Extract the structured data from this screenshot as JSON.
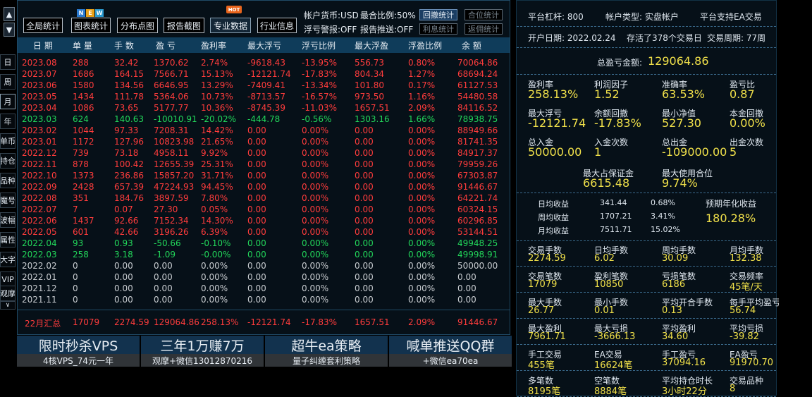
{
  "sidebar": {
    "up_arrow": "▲",
    "down_arrow": "▼",
    "items": [
      "日",
      "周",
      "月",
      "年",
      "单币",
      "持仓",
      "品种",
      "魔号",
      "波幅",
      "属性",
      "大字",
      "VIP",
      "观摩",
      "∨"
    ]
  },
  "toolbar": {
    "buttons": [
      "全局统计",
      "图表统计",
      "分布点图",
      "报告截图",
      "专业数据",
      "行业信息"
    ],
    "active_button": "专业数据",
    "hot_badge": "HOT",
    "new_badge": [
      "N",
      "E",
      "W"
    ],
    "account_currency": "帐户货币:USD",
    "hedge_ratio": "最合比例:50%",
    "float_alert": "浮亏警报:OFF",
    "report_push": "报告推送:OFF",
    "stat_buttons": [
      "回撤统计",
      "合位统计",
      "利息统计",
      "返佣统计"
    ]
  },
  "table": {
    "headers": [
      "日 期",
      "单 量",
      "手 数",
      "盈 亏",
      "盈利率",
      "最大浮亏",
      "浮亏比例",
      "最大浮盈",
      "浮盈比例",
      "余 额"
    ],
    "rows": [
      {
        "c": "r",
        "v": [
          "2023.08",
          "288",
          "32.42",
          "1370.62",
          "2.74%",
          "-9618.43",
          "-13.95%",
          "556.73",
          "0.80%",
          "70064.86"
        ]
      },
      {
        "c": "r",
        "v": [
          "2023.07",
          "1686",
          "164.15",
          "7566.71",
          "15.13%",
          "-12121.74",
          "-17.83%",
          "804.34",
          "1.27%",
          "68694.24"
        ]
      },
      {
        "c": "r",
        "v": [
          "2023.06",
          "1580",
          "134.56",
          "6646.95",
          "13.29%",
          "-7409.41",
          "-13.34%",
          "101.80",
          "0.17%",
          "61127.53"
        ]
      },
      {
        "c": "r",
        "v": [
          "2023.05",
          "1434",
          "111.78",
          "5364.06",
          "10.73%",
          "-8713.57",
          "-16.57%",
          "973.50",
          "1.16%",
          "54480.58"
        ]
      },
      {
        "c": "r",
        "v": [
          "2023.04",
          "1086",
          "73.65",
          "5177.77",
          "10.36%",
          "-8745.39",
          "-11.03%",
          "1657.51",
          "2.09%",
          "84116.52"
        ]
      },
      {
        "c": "g",
        "v": [
          "2023.03",
          "624",
          "140.63",
          "-10010.91",
          "-20.02%",
          "-444.78",
          "-0.56%",
          "1303.16",
          "1.66%",
          "78938.75"
        ]
      },
      {
        "c": "r",
        "v": [
          "2023.02",
          "1044",
          "97.33",
          "7208.31",
          "14.42%",
          "0.00",
          "0.00%",
          "0.00",
          "0.00%",
          "88949.66"
        ]
      },
      {
        "c": "r",
        "v": [
          "2023.01",
          "1172",
          "127.96",
          "10823.98",
          "21.65%",
          "0.00",
          "0.00%",
          "0.00",
          "0.00%",
          "81741.35"
        ]
      },
      {
        "c": "r",
        "v": [
          "2022.12",
          "739",
          "73.18",
          "4958.11",
          "9.92%",
          "0.00",
          "0.00%",
          "0.00",
          "0.00%",
          "84917.37"
        ]
      },
      {
        "c": "r",
        "v": [
          "2022.11",
          "878",
          "100.42",
          "12655.39",
          "25.31%",
          "0.00",
          "0.00%",
          "0.00",
          "0.00%",
          "79959.26"
        ]
      },
      {
        "c": "r",
        "v": [
          "2022.10",
          "1373",
          "236.86",
          "15857.20",
          "31.71%",
          "0.00",
          "0.00%",
          "0.00",
          "0.00%",
          "67303.87"
        ]
      },
      {
        "c": "r",
        "v": [
          "2022.09",
          "2428",
          "657.39",
          "47224.93",
          "94.45%",
          "0.00",
          "0.00%",
          "0.00",
          "0.00%",
          "91446.67"
        ]
      },
      {
        "c": "r",
        "v": [
          "2022.08",
          "351",
          "184.76",
          "3897.59",
          "7.80%",
          "0.00",
          "0.00%",
          "0.00",
          "0.00%",
          "64221.74"
        ]
      },
      {
        "c": "r",
        "v": [
          "2022.07",
          "7",
          "0.07",
          "27.30",
          "0.05%",
          "0.00",
          "0.00%",
          "0.00",
          "0.00%",
          "60324.15"
        ]
      },
      {
        "c": "r",
        "v": [
          "2022.06",
          "1437",
          "92.66",
          "7152.34",
          "14.30%",
          "0.00",
          "0.00%",
          "0.00",
          "0.00%",
          "60296.85"
        ]
      },
      {
        "c": "r",
        "v": [
          "2022.05",
          "601",
          "42.66",
          "3196.26",
          "6.39%",
          "0.00",
          "0.00%",
          "0.00",
          "0.00%",
          "53144.51"
        ]
      },
      {
        "c": "g",
        "v": [
          "2022.04",
          "93",
          "0.93",
          "-50.66",
          "-0.10%",
          "0.00",
          "0.00%",
          "0.00",
          "0.00%",
          "49948.25"
        ]
      },
      {
        "c": "g",
        "v": [
          "2022.03",
          "258",
          "3.18",
          "-1.09",
          "-0.00%",
          "0.00",
          "0.00%",
          "0.00",
          "0.00%",
          "49998.91"
        ]
      },
      {
        "c": "w",
        "v": [
          "2022.02",
          "0",
          "0.00",
          "0.00",
          "0.00%",
          "0.00",
          "0.00%",
          "0.00",
          "0.00%",
          "50000.00"
        ]
      },
      {
        "c": "w",
        "v": [
          "2022.01",
          "0",
          "0.00",
          "0.00",
          "0.00%",
          "0.00",
          "0.00%",
          "0.00",
          "0.00%",
          "0.00"
        ]
      },
      {
        "c": "w",
        "v": [
          "2021.12",
          "0",
          "0.00",
          "0.00",
          "0.00%",
          "0.00",
          "0.00%",
          "0.00",
          "0.00%",
          "0.00"
        ]
      },
      {
        "c": "w",
        "v": [
          "2021.11",
          "0",
          "0.00",
          "0.00",
          "0.00%",
          "0.00",
          "0.00%",
          "0.00",
          "0.00%",
          "0.00"
        ]
      }
    ],
    "summary": [
      "22月汇总",
      "17079",
      "2274.59",
      "129064.86",
      "258.13%",
      "-12121.74",
      "-17.83%",
      "1657.51",
      "2.09%",
      "91446.67"
    ]
  },
  "ads": [
    {
      "title": "限时秒杀VPS",
      "sub": "4核VPS_74元一年"
    },
    {
      "title": "三年1万赚7万",
      "sub": "观摩+微信13012870216"
    },
    {
      "title": "超牛ea策略",
      "sub": "量子纠缠套利策略"
    },
    {
      "title": "喊单推送QQ群",
      "sub": "+微信ea70ea"
    }
  ],
  "panel": {
    "leverage": "平台杠杆: 800",
    "account_type": "帐户类型: 实盘帐户",
    "ea_support": "平台支持EA交易",
    "open_date": "开户日期: 2022.02.24",
    "alive": "存活了378个交易日",
    "period": "交易周期: 77周",
    "total_label": "总盈亏金额:",
    "total_value": "129064.86",
    "grid1": [
      {
        "l": "盈利率",
        "v": "258.13%"
      },
      {
        "l": "利润因子",
        "v": "1.52"
      },
      {
        "l": "准确率",
        "v": "63.53%"
      },
      {
        "l": "盈亏比",
        "v": "0.87"
      },
      {
        "l": "最大浮亏",
        "v": "-12121.74"
      },
      {
        "l": "余额回撤",
        "v": "-17.83%"
      },
      {
        "l": "最小净值",
        "v": "527.30"
      },
      {
        "l": "本金回撤",
        "v": "0.00%"
      },
      {
        "l": "总入金",
        "v": "50000.00"
      },
      {
        "l": "入金次数",
        "v": "1"
      },
      {
        "l": "总出金",
        "v": "-109000.00"
      },
      {
        "l": "出金次数",
        "v": "5"
      }
    ],
    "margin_label": "最大占保证金",
    "margin_value": "6615.48",
    "pos_label": "最大使用合位",
    "pos_value": "9.74%",
    "returns": [
      {
        "l": "日均收益",
        "v": "341.44",
        "p": "0.68%"
      },
      {
        "l": "周均收益",
        "v": "1707.21",
        "p": "3.41%"
      },
      {
        "l": "月均收益",
        "v": "7511.71",
        "p": "15.02%"
      }
    ],
    "annual_label": "预期年化收益",
    "annual_value": "180.28%",
    "grid2": [
      {
        "l": "交易手数",
        "v": "2274.59"
      },
      {
        "l": "日均手数",
        "v": "6.02"
      },
      {
        "l": "周均手数",
        "v": "30.09"
      },
      {
        "l": "月均手数",
        "v": "132.38"
      },
      {
        "l": "交易笔数",
        "v": "17079"
      },
      {
        "l": "盈利笔数",
        "v": "10850"
      },
      {
        "l": "亏损笔数",
        "v": "6186"
      },
      {
        "l": "交易频率",
        "v": "45笔/天"
      },
      {
        "l": "最大手数",
        "v": "26.77"
      },
      {
        "l": "最小手数",
        "v": "0.01"
      },
      {
        "l": "平均开合手数",
        "v": "0.13"
      },
      {
        "l": "每手平均盈亏",
        "v": "56.74"
      },
      {
        "l": "最大盈利",
        "v": "7961.71"
      },
      {
        "l": "最大亏损",
        "v": "-3666.13"
      },
      {
        "l": "平均盈利",
        "v": "34.60"
      },
      {
        "l": "平均亏损",
        "v": "-39.82"
      },
      {
        "l": "手工交易",
        "v": "455笔"
      },
      {
        "l": "EA交易",
        "v": "16624笔"
      },
      {
        "l": "手工盈亏",
        "v": "37094.16"
      },
      {
        "l": "EA盈亏",
        "v": "91970.70"
      },
      {
        "l": "多笔数",
        "v": "8195笔"
      },
      {
        "l": "空笔数",
        "v": "8884笔"
      },
      {
        "l": "平均持仓时长",
        "v": "3小时22分"
      },
      {
        "l": "交易品种",
        "v": "8"
      }
    ]
  }
}
